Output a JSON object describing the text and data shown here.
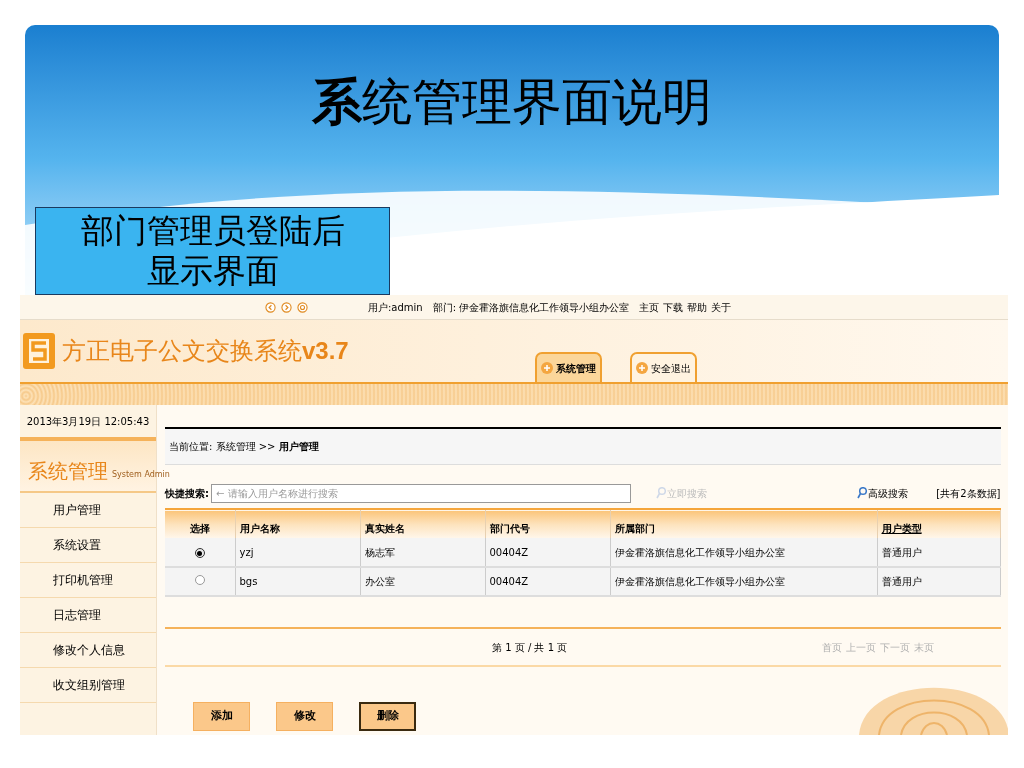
{
  "slide": {
    "title": "**系**统管理界面说明",
    "callout": "部门管理员登陆后显示界面"
  },
  "app": {
    "user_info": "用户:admin",
    "dept_info": "部门: 伊金霍洛旗信息化工作领导小组办公室",
    "top_links": [
      "主页",
      "下载",
      "帮助",
      "关于"
    ],
    "title": "方正电子公文交换系统",
    "version": "v3.7",
    "tabs": [
      {
        "label": "系统管理",
        "selected": true
      },
      {
        "label": "安全退出",
        "selected": false
      }
    ],
    "datetime": "2013年3月19日 12:05:43",
    "sidebar": {
      "title": "系统管理",
      "subtitle": "System Admin",
      "items": [
        "用户管理",
        "系统设置",
        "打印机管理",
        "日志管理",
        "修改个人信息",
        "收文组别管理"
      ]
    },
    "breadcrumb": "当前位置: 系统管理 >> **用户管理**",
    "search": {
      "label": "快捷搜索:",
      "placeholder": "← 请输入用户名称进行搜索",
      "button": "立即搜索",
      "advanced": "高级搜索",
      "count": "[共有2条数据]"
    },
    "table": {
      "columns": [
        "选择",
        "用户名称",
        "真实姓名",
        "部门代号",
        "所属部门",
        "用户类型"
      ],
      "rows": [
        {
          "selected": true,
          "cells": [
            "",
            "yzj",
            "杨志军",
            "00404Z",
            "伊金霍洛旗信息化工作领导小组办公室",
            "普通用户"
          ]
        },
        {
          "selected": false,
          "cells": [
            "",
            "bgs",
            "办公室",
            "00404Z",
            "伊金霍洛旗信息化工作领导小组办公室",
            "普通用户"
          ]
        }
      ]
    },
    "pager": {
      "info": "第 1 页 / 共 1 页",
      "links": [
        {
          "label": "首页",
          "disabled": true
        },
        {
          "label": "上一页",
          "disabled": true
        },
        {
          "label": "下一页",
          "disabled": true
        },
        {
          "label": "末页",
          "disabled": true
        }
      ]
    },
    "buttons": [
      {
        "label": "添加",
        "focused": false
      },
      {
        "label": "修改",
        "focused": false
      },
      {
        "label": "删除",
        "focused": true
      }
    ]
  }
}
